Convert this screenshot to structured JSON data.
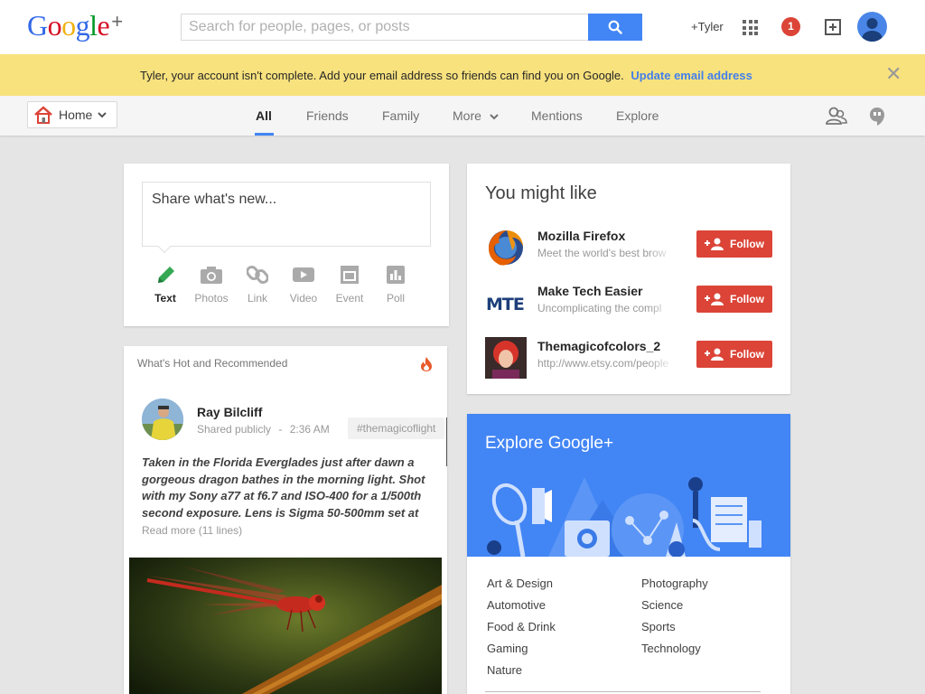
{
  "colors": {
    "accent_blue": "#4285f4",
    "banner_yellow": "#f8e27e",
    "follow_red": "#db4437",
    "link_blue": "#427fed"
  },
  "header": {
    "logo_text": "Google+",
    "search_placeholder": "Search for people, pages, or posts",
    "search_value": "",
    "user_label": "+Tyler",
    "notification_count": "1"
  },
  "banner": {
    "message": "Tyler, your account isn't complete. Add your email address so friends can find you on Google.",
    "link": "Update email address"
  },
  "nav": {
    "home_label": "Home",
    "tabs": [
      {
        "label": "All",
        "active": true
      },
      {
        "label": "Friends",
        "active": false
      },
      {
        "label": "Family",
        "active": false
      },
      {
        "label": "More",
        "active": false
      },
      {
        "label": "Mentions",
        "active": false
      },
      {
        "label": "Explore",
        "active": false
      }
    ]
  },
  "share": {
    "prompt": "Share what's new...",
    "options": [
      {
        "label": "Text",
        "icon": "pencil-icon",
        "active": true
      },
      {
        "label": "Photos",
        "icon": "camera-icon",
        "active": false
      },
      {
        "label": "Link",
        "icon": "link-icon",
        "active": false
      },
      {
        "label": "Video",
        "icon": "video-icon",
        "active": false
      },
      {
        "label": "Event",
        "icon": "event-icon",
        "active": false
      },
      {
        "label": "Poll",
        "icon": "poll-icon",
        "active": false
      }
    ]
  },
  "hot": {
    "title": "What's Hot and Recommended",
    "post": {
      "author": "Ray Bilcliff",
      "visibility": "Shared publicly",
      "separator": "-",
      "time": "2:36 AM",
      "tag": "#themagicoflight",
      "body": "Taken in the Florida Everglades just after dawn a gorgeous dragon bathes in the morning light. Shot with my Sony a77 at f6.7 and ISO-400 for a 1/500th second exposure. Lens is Sigma 50-500mm set at",
      "read_more": "Read more (11 lines)"
    }
  },
  "suggestions": {
    "title": "You might like",
    "follow_label": "Follow",
    "items": [
      {
        "name": "Mozilla Firefox",
        "subtitle": "Meet the world's best brow"
      },
      {
        "name": "Make Tech Easier",
        "subtitle": "Uncomplicating the compl"
      },
      {
        "name": "Themagicofcolors_2",
        "subtitle": "http://www.etsy.com/people"
      }
    ]
  },
  "explore": {
    "title": "Explore Google+",
    "categories_left": [
      "Art & Design",
      "Automotive",
      "Food & Drink",
      "Gaming",
      "Nature"
    ],
    "categories_right": [
      "Photography",
      "Science",
      "Sports",
      "Technology"
    ]
  }
}
